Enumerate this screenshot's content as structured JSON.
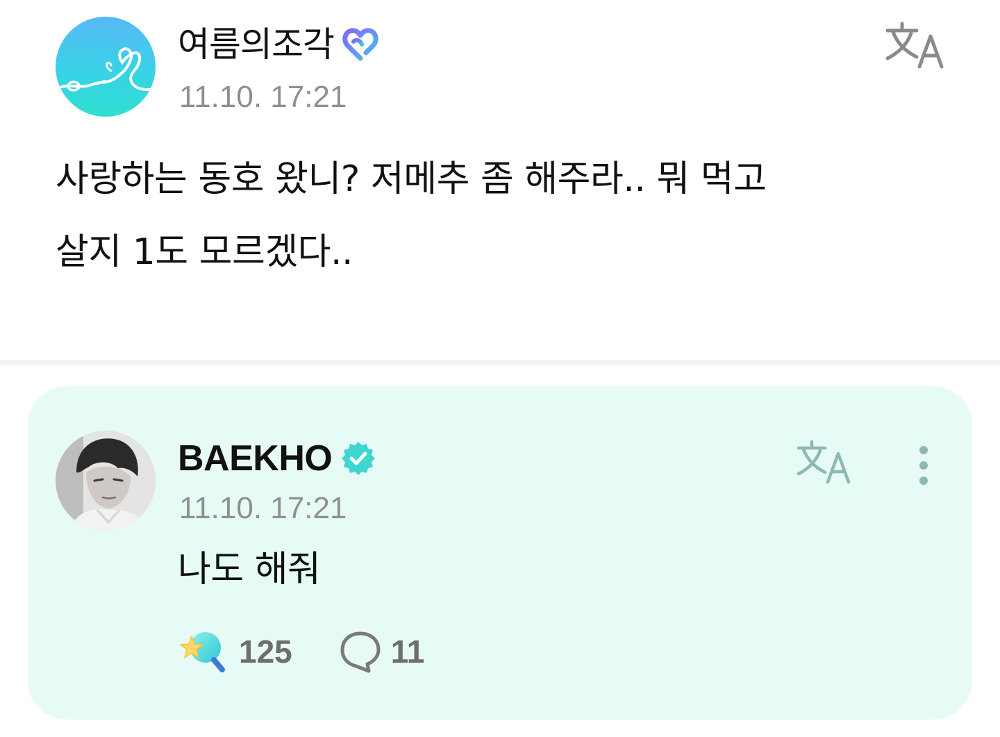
{
  "post": {
    "author": {
      "name": "여름의조각",
      "avatar_icon": "ribbon-heart-avatar",
      "badge_icon": "fan-heart-badge-icon"
    },
    "timestamp": "11.10. 17:21",
    "translate_icon": "translate-icon",
    "text": "사랑하는 동호 왔니? 저메추 좀 해주라.. 뭐 먹고\n살지 1도 모르겠다.."
  },
  "reply": {
    "author": {
      "name": "BAEKHO",
      "avatar_icon": "artist-photo-avatar",
      "badge_icon": "verified-badge-icon"
    },
    "timestamp": "11.10. 17:21",
    "translate_icon": "translate-icon",
    "more_icon": "more-vertical-icon",
    "text": "나도 해줘",
    "stats": {
      "likes": {
        "icon": "star-wand-like-icon",
        "count": "125"
      },
      "comments": {
        "icon": "speech-bubble-icon",
        "count": "11"
      }
    }
  },
  "colors": {
    "card_background": "#e6fbf6",
    "muted_text": "#8f8f8f",
    "count_text": "#6e6e6e",
    "accent_teal": "#3ed6d0",
    "translate_icon_top": "#8a8a8a",
    "translate_icon_reply": "#8fb8b2"
  }
}
